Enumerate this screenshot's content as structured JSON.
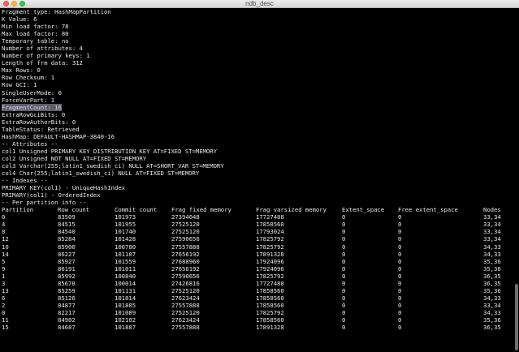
{
  "window": {
    "title": "ndb_desc"
  },
  "meta_lines": [
    "Fragment type: HashMapPartition",
    "K Value: 6",
    "Min load factor: 78",
    "Max load factor: 80",
    "Temporary table: no",
    "Number of attributes: 4",
    "Number of primary keys: 1",
    "Length of frm data: 312",
    "Max Rows: 0",
    "Row Checksum: 1",
    "Row GCI: 1",
    "SingleUserMode: 0",
    "ForceVarPart: 1",
    "FragmentCount: 16",
    "ExtraRowGciBits: 0",
    "ExtraRowAuthorBits: 0",
    "TableStatus: Retrieved",
    "HashMap: DEFAULT-HASHMAP-3840-16",
    "-- Attributes --",
    "col1 Unsigned PRIMARY KEY DISTRIBUTION KEY AT=FIXED ST=MEMORY",
    "col2 Unsigned NOT NULL AT=FIXED ST=MEMORY",
    "col3 Varchar(255;latin1_swedish_ci) NULL AT=SHORT_VAR ST=MEMORY",
    "col4 Char(255;latin1_swedish_ci) NULL AT=FIXED ST=MEMORY",
    "-- Indexes --",
    "PRIMARY KEY(col1) - UniqueHashIndex",
    "PRIMARY(col1) - OrderedIndex",
    "-- Per partition info --"
  ],
  "partition_table": {
    "headers": [
      "Partition",
      "Row count",
      "Commit count",
      "Frag fixed memory",
      "Frag varsized memory",
      "Extent_space",
      "Free extent_space",
      "Nodes"
    ],
    "rows": [
      [
        "0",
        "83509",
        "101973",
        "27394048",
        "17727488",
        "0",
        "0",
        "33,34"
      ],
      [
        "4",
        "84515",
        "101955",
        "27525120",
        "17858560",
        "0",
        "0",
        "33,34"
      ],
      [
        "8",
        "84540",
        "101740",
        "27525120",
        "17793024",
        "0",
        "0",
        "33,34"
      ],
      [
        "12",
        "85284",
        "101428",
        "27590656",
        "17825792",
        "0",
        "0",
        "33,34"
      ],
      [
        "10",
        "85900",
        "100780",
        "27557888",
        "17825792",
        "0",
        "0",
        "34,33"
      ],
      [
        "14",
        "86227",
        "101107",
        "27656192",
        "17891328",
        "0",
        "0",
        "34,33"
      ],
      [
        "5",
        "85927",
        "101559",
        "27688960",
        "17924096",
        "0",
        "0",
        "35,36"
      ],
      [
        "9",
        "86191",
        "101011",
        "27656192",
        "17924096",
        "0",
        "0",
        "35,36"
      ],
      [
        "1",
        "85992",
        "100840",
        "27590656",
        "17825792",
        "0",
        "0",
        "36,35"
      ],
      [
        "3",
        "85678",
        "100014",
        "27426816",
        "17727488",
        "0",
        "0",
        "36,35"
      ],
      [
        "13",
        "85259",
        "101131",
        "27525120",
        "17858560",
        "0",
        "0",
        "35,36"
      ],
      [
        "6",
        "85126",
        "101814",
        "27623424",
        "17858560",
        "0",
        "0",
        "34,33"
      ],
      [
        "2",
        "84877",
        "101805",
        "27557888",
        "17858560",
        "0",
        "0",
        "33,34"
      ],
      [
        "0",
        "82217",
        "101089",
        "27525120",
        "17825792",
        "0",
        "0",
        "34,33"
      ],
      [
        "11",
        "84902",
        "102102",
        "27623424",
        "17858560",
        "0",
        "0",
        "35,36"
      ],
      [
        "15",
        "84687",
        "101887",
        "27557888",
        "17891328",
        "0",
        "0",
        "36,35"
      ]
    ]
  }
}
